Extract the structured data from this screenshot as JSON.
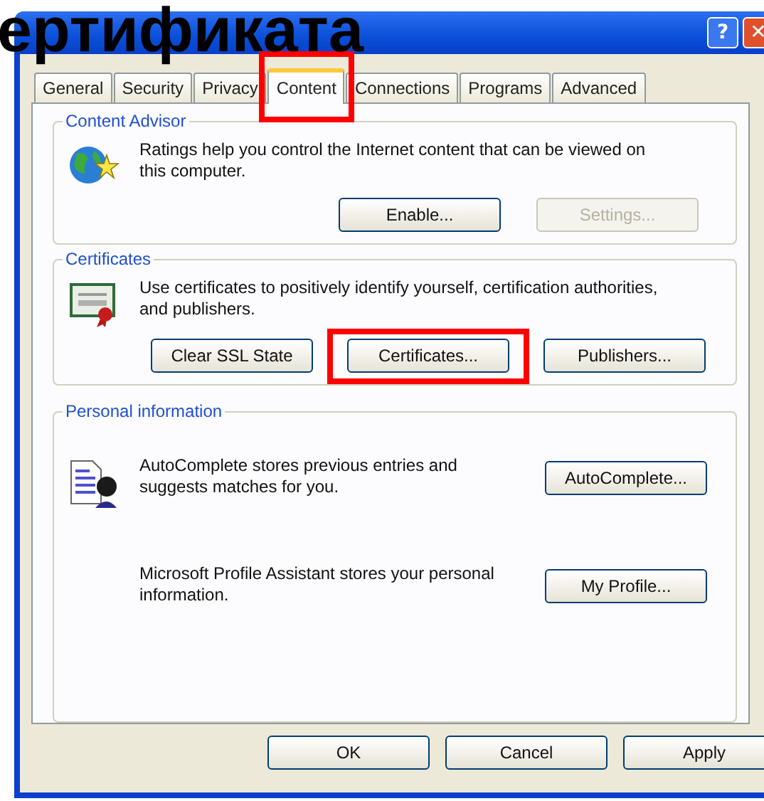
{
  "overlay_caption": "ертификата",
  "window": {
    "buttons": [
      {
        "kind": "help",
        "label": "?"
      },
      {
        "kind": "close",
        "label": "✕"
      }
    ]
  },
  "tabs": [
    {
      "label": "General",
      "selected": false,
      "highlighted": false
    },
    {
      "label": "Security",
      "selected": false,
      "highlighted": false
    },
    {
      "label": "Privacy",
      "selected": false,
      "highlighted": false
    },
    {
      "label": "Content",
      "selected": true,
      "highlighted": true
    },
    {
      "label": "Connections",
      "selected": false,
      "highlighted": false
    },
    {
      "label": "Programs",
      "selected": false,
      "highlighted": false
    },
    {
      "label": "Advanced",
      "selected": false,
      "highlighted": false
    }
  ],
  "groups": [
    {
      "title": "Content Advisor",
      "rows": [
        {
          "text": "Ratings help you control the Internet content that can be viewed on this computer."
        }
      ],
      "buttons": [
        {
          "label": "Enable...",
          "disabled": false,
          "highlighted": false
        },
        {
          "label": "Settings...",
          "disabled": true,
          "highlighted": false
        }
      ]
    },
    {
      "title": "Certificates",
      "rows": [
        {
          "text": "Use certificates to positively identify yourself, certification authorities, and publishers."
        }
      ],
      "buttons": [
        {
          "label": "Clear SSL State",
          "disabled": false,
          "highlighted": false
        },
        {
          "label": "Certificates...",
          "disabled": false,
          "highlighted": true
        },
        {
          "label": "Publishers...",
          "disabled": false,
          "highlighted": false
        }
      ]
    },
    {
      "title": "Personal information",
      "rows": [
        {
          "text": "AutoComplete stores previous entries and suggests matches for you.",
          "buttons": [
            "AutoComplete..."
          ]
        },
        {
          "text": "Microsoft Profile Assistant stores your personal information.",
          "buttons": [
            "My Profile..."
          ]
        }
      ]
    }
  ],
  "dialog_buttons": [
    "OK",
    "Cancel",
    "Apply"
  ]
}
